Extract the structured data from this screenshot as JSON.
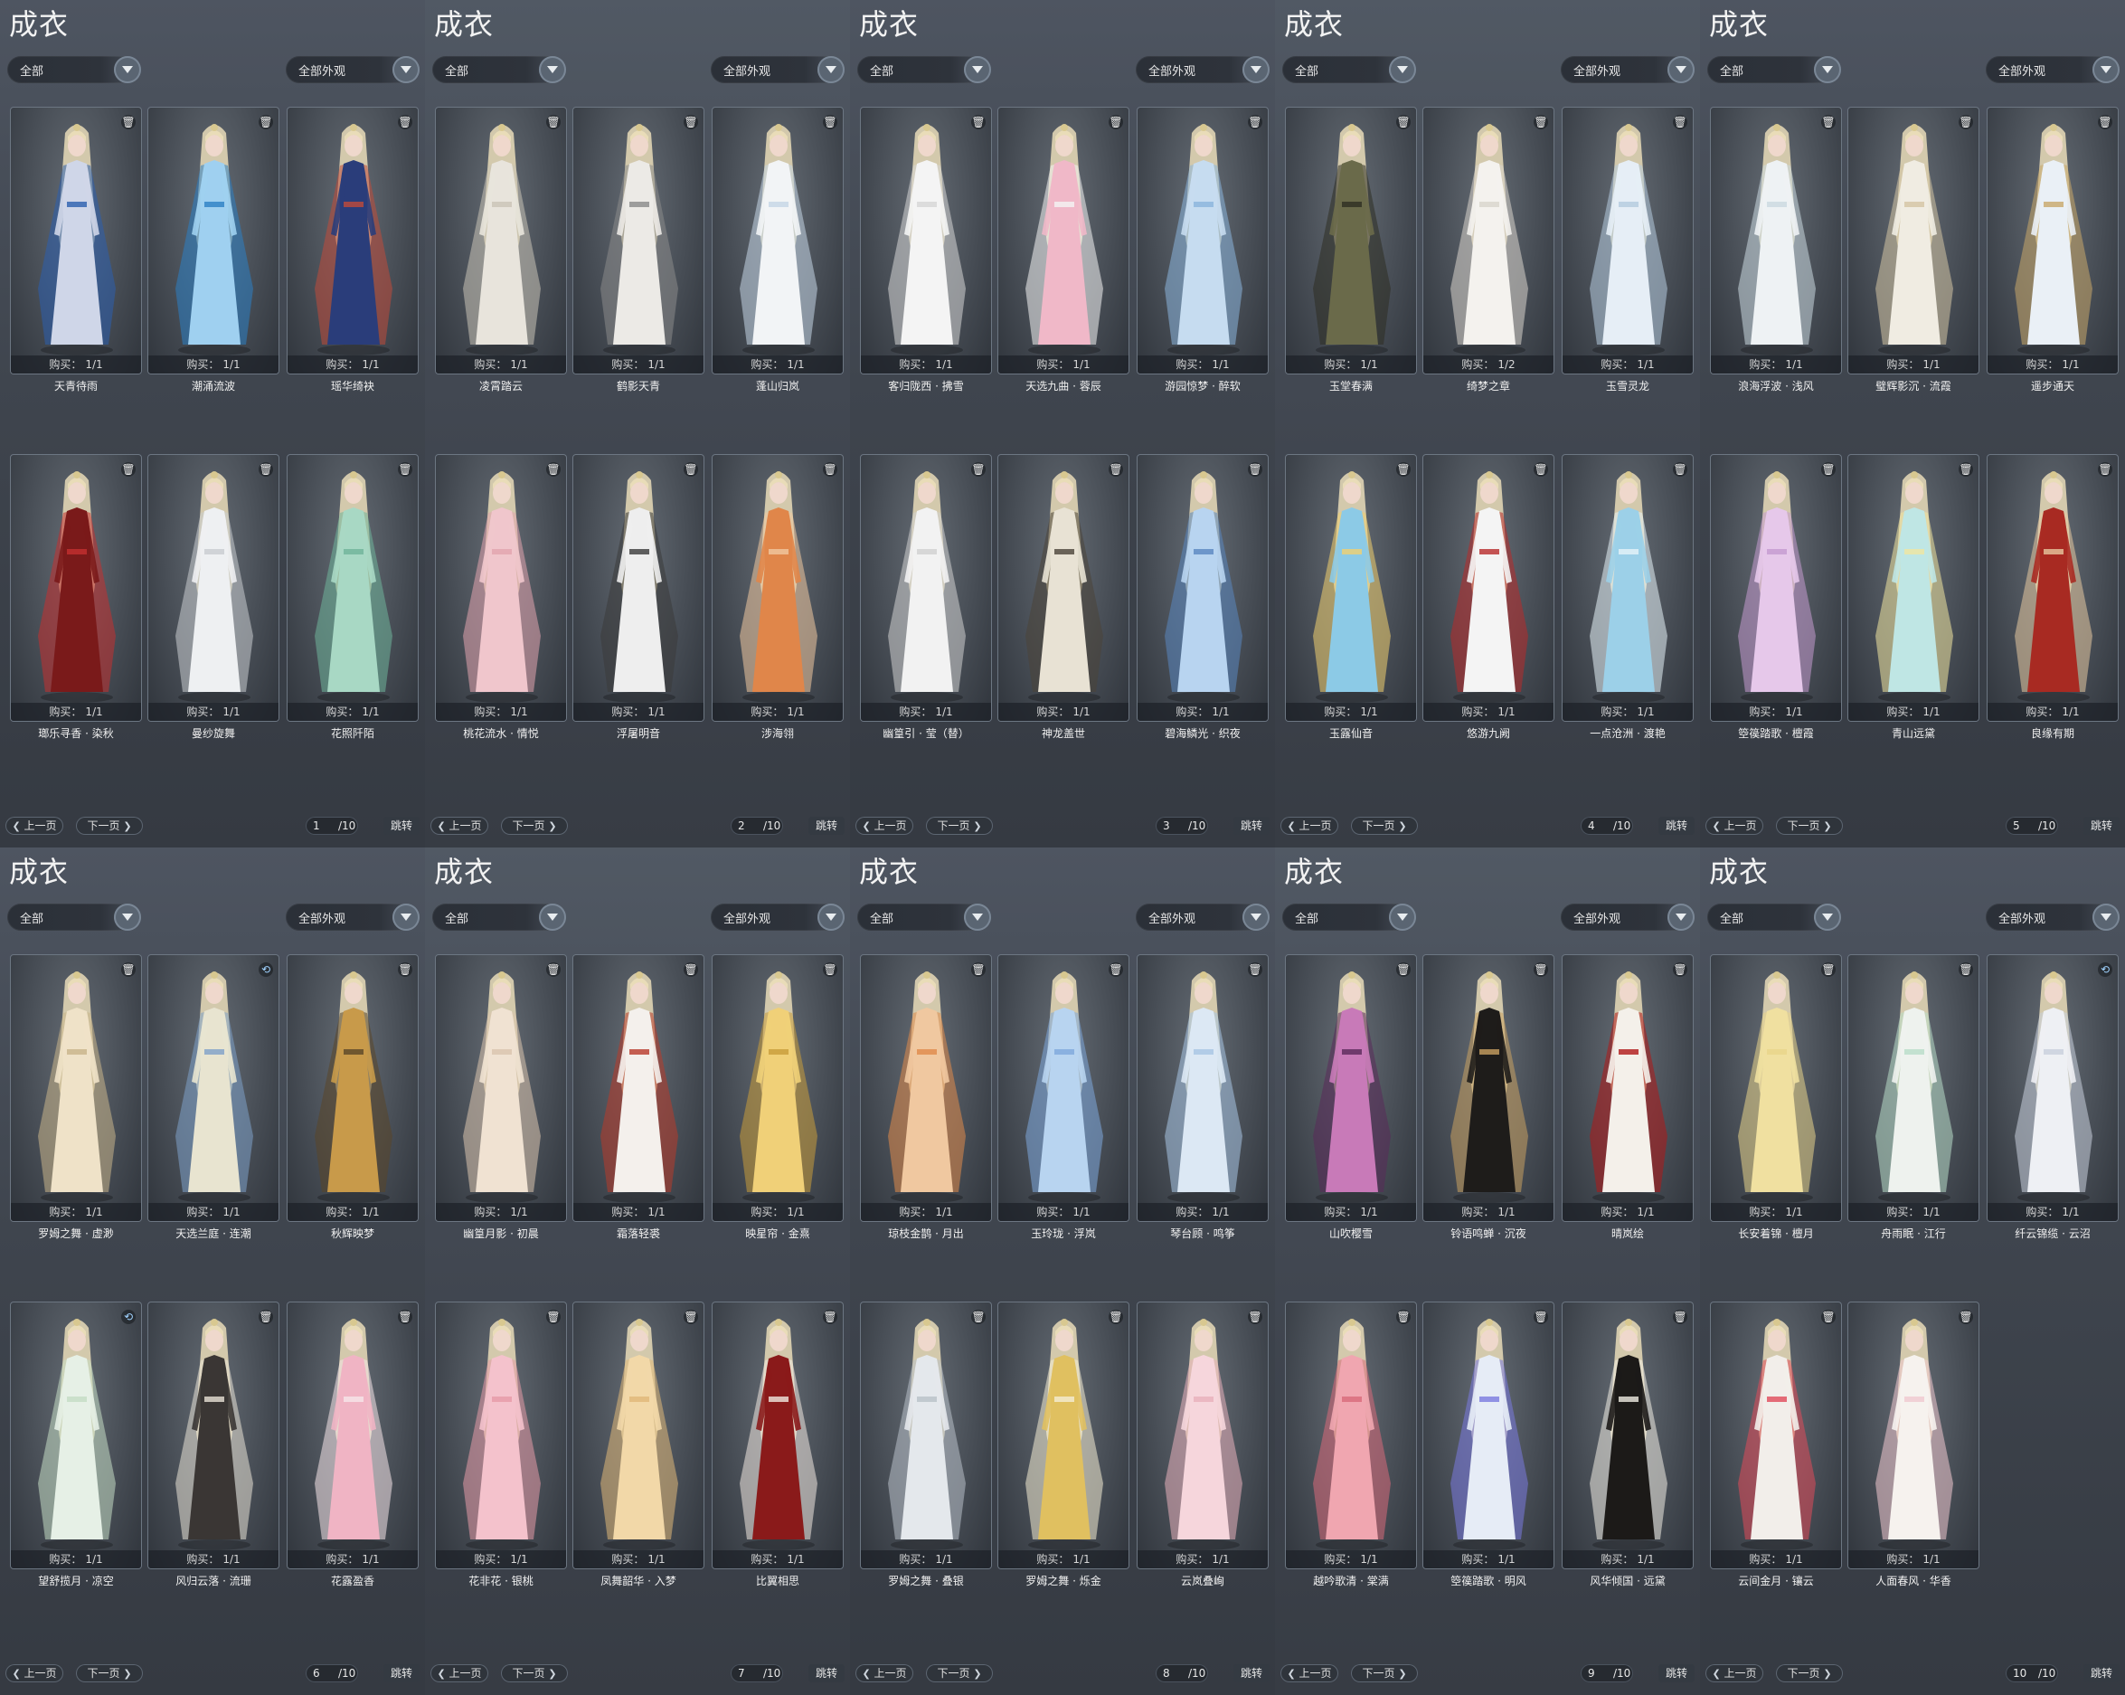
{
  "panel_title": "成衣",
  "filter_left": "全部",
  "filter_right": "全部外观",
  "purchase_label": "购买：",
  "prev_label": "上一页",
  "next_label": "下一页",
  "jump_label": "跳转",
  "total_pages": "/10",
  "colors": {
    "panel_bg": "#454b55",
    "card_border": "#6c7682",
    "text": "#f0f0f0"
  },
  "panels": [
    {
      "page": "1",
      "items": [
        {
          "name": "天青待雨",
          "count": "1/1",
          "icon": "trash-icon",
          "palette": [
            "#cfd6e8",
            "#2b5fae"
          ]
        },
        {
          "name": "潮涌流波",
          "count": "1/1",
          "icon": "trash-icon",
          "palette": [
            "#9fd0f0",
            "#2c7fc4"
          ]
        },
        {
          "name": "瑶华绮袂",
          "count": "1/1",
          "icon": "trash-icon",
          "palette": [
            "#2a3d7a",
            "#c04a3a"
          ]
        },
        {
          "name": "瑯乐寻香 · 染秋",
          "count": "1/1",
          "icon": "trash-icon",
          "palette": [
            "#7a1a1a",
            "#c43030"
          ]
        },
        {
          "name": "曼纱旋舞",
          "count": "1/1",
          "icon": "trash-icon",
          "palette": [
            "#eef0f2",
            "#c8ccd0"
          ]
        },
        {
          "name": "花照阡陌",
          "count": "1/1",
          "icon": "trash-icon",
          "palette": [
            "#a8d8c4",
            "#6fb49a"
          ]
        }
      ]
    },
    {
      "page": "2",
      "items": [
        {
          "name": "凌霄踏云",
          "count": "1/1",
          "icon": "trash-icon",
          "palette": [
            "#e8e4dc",
            "#c9c3b6"
          ]
        },
        {
          "name": "鹤影天青",
          "count": "1/1",
          "icon": "trash-icon",
          "palette": [
            "#eceae6",
            "#8a8a8a"
          ]
        },
        {
          "name": "蓬山归岚",
          "count": "1/1",
          "icon": "trash-icon",
          "palette": [
            "#f2f4f6",
            "#c4d6e6"
          ]
        },
        {
          "name": "桃花流水 · 情悦",
          "count": "1/1",
          "icon": "trash-icon",
          "palette": [
            "#f0c6cc",
            "#e2a4ae"
          ]
        },
        {
          "name": "浮屠明音",
          "count": "1/1",
          "icon": "trash-icon",
          "palette": [
            "#eeeeee",
            "#3a3a3a"
          ]
        },
        {
          "name": "涉海翎",
          "count": "1/1",
          "icon": "trash-icon",
          "palette": [
            "#e0864a",
            "#f0c8a0"
          ]
        }
      ]
    },
    {
      "page": "3",
      "items": [
        {
          "name": "客归陇西 · 拂雪",
          "count": "1/1",
          "icon": "trash-icon",
          "palette": [
            "#f4f4f4",
            "#d6d6d6"
          ]
        },
        {
          "name": "天选九曲 · 蓉辰",
          "count": "1/1",
          "icon": "trash-icon",
          "palette": [
            "#f0b8c8",
            "#f4f4f4"
          ]
        },
        {
          "name": "游园惊梦 · 醉软",
          "count": "1/1",
          "icon": "trash-icon",
          "palette": [
            "#c6dcf0",
            "#8ab4dc"
          ]
        },
        {
          "name": "幽篁引 · 莹（替）",
          "count": "1/1",
          "icon": "trash-icon",
          "palette": [
            "#f2f2f2",
            "#cfcfcf"
          ]
        },
        {
          "name": "神龙盖世",
          "count": "1/1",
          "icon": "trash-icon",
          "palette": [
            "#e8e2d4",
            "#4a4438"
          ]
        },
        {
          "name": "碧海鳞光 · 织夜",
          "count": "1/1",
          "icon": "trash-icon",
          "palette": [
            "#b8d4f0",
            "#5a86c0"
          ]
        }
      ]
    },
    {
      "page": "4",
      "items": [
        {
          "name": "玉堂春满",
          "count": "1/1",
          "icon": "trash-icon",
          "palette": [
            "#6a6a4a",
            "#2e2e22"
          ]
        },
        {
          "name": "绮梦之章",
          "count": "1/2",
          "icon": "trash-icon",
          "palette": [
            "#f4f2ee",
            "#d8d4cc"
          ]
        },
        {
          "name": "玉雪灵龙",
          "count": "1/1",
          "icon": "trash-icon",
          "palette": [
            "#e6eef6",
            "#b4cade"
          ]
        },
        {
          "name": "玉露仙音",
          "count": "1/1",
          "icon": "trash-icon",
          "palette": [
            "#8ccae6",
            "#f0d070"
          ]
        },
        {
          "name": "悠游九阙",
          "count": "1/1",
          "icon": "trash-icon",
          "palette": [
            "#f4f4f4",
            "#b82a2a"
          ]
        },
        {
          "name": "一点沧洲 · 渡艳",
          "count": "1/1",
          "icon": "trash-icon",
          "palette": [
            "#9cd0e8",
            "#e6f2f8"
          ]
        }
      ]
    },
    {
      "page": "5",
      "items": [
        {
          "name": "浪海浮波 · 浅风",
          "count": "1/1",
          "icon": "trash-icon",
          "palette": [
            "#eef2f4",
            "#cad8e0"
          ]
        },
        {
          "name": "璧辉影沉 · 流霞",
          "count": "1/1",
          "icon": "trash-icon",
          "palette": [
            "#f0ece2",
            "#d4c4a4"
          ]
        },
        {
          "name": "遥步通天",
          "count": "1/1",
          "icon": "trash-icon",
          "palette": [
            "#eaf0f6",
            "#c8a86a"
          ]
        },
        {
          "name": "箜篌踏歌 · 檀霞",
          "count": "1/1",
          "icon": "trash-icon",
          "palette": [
            "#e6c8ea",
            "#c49ad0"
          ]
        },
        {
          "name": "青山远黛",
          "count": "1/1",
          "icon": "trash-icon",
          "palette": [
            "#bfe6e4",
            "#f0e6a0"
          ]
        },
        {
          "name": "良缘有期",
          "count": "1/1",
          "icon": "trash-icon",
          "palette": [
            "#a82a22",
            "#e6c8a0"
          ]
        }
      ]
    },
    {
      "page": "6",
      "items": [
        {
          "name": "罗姆之舞 · 虚渺",
          "count": "1/1",
          "icon": "trash-icon",
          "palette": [
            "#efe2c8",
            "#c8b48a"
          ]
        },
        {
          "name": "天选兰庭 · 连潮",
          "count": "1/1",
          "icon": "blue",
          "palette": [
            "#e8e4d0",
            "#7ea0c8"
          ]
        },
        {
          "name": "秋辉映梦",
          "count": "1/1",
          "icon": "trash-icon",
          "palette": [
            "#c89a4a",
            "#5a4628"
          ]
        },
        {
          "name": "望舒揽月 · 凉空",
          "count": "1/1",
          "icon": "blue",
          "palette": [
            "#e6f0e6",
            "#c4dcc4"
          ]
        },
        {
          "name": "风归云落 · 流珊",
          "count": "1/1",
          "icon": "trash-icon",
          "palette": [
            "#3a3634",
            "#e8e2d6"
          ]
        },
        {
          "name": "花露盈香",
          "count": "1/1",
          "icon": "trash-icon",
          "palette": [
            "#f0b4c4",
            "#f6e6ea"
          ]
        }
      ]
    },
    {
      "page": "7",
      "items": [
        {
          "name": "幽篁月影 · 初晨",
          "count": "1/1",
          "icon": "trash-icon",
          "palette": [
            "#f0e2d2",
            "#dac4ae"
          ]
        },
        {
          "name": "霜落轻裘",
          "count": "1/1",
          "icon": "trash-icon",
          "palette": [
            "#f4f0ec",
            "#b83a2a"
          ]
        },
        {
          "name": "映星帘 · 金熹",
          "count": "1/1",
          "icon": "trash-icon",
          "palette": [
            "#f0d078",
            "#c89c3a"
          ]
        },
        {
          "name": "花非花 · 银桃",
          "count": "1/1",
          "icon": "trash-icon",
          "palette": [
            "#f4c2cc",
            "#e69aa8"
          ]
        },
        {
          "name": "凤舞韶华 · 入梦",
          "count": "1/1",
          "icon": "trash-icon",
          "palette": [
            "#f2d8a8",
            "#e0b878"
          ]
        },
        {
          "name": "比翼相思",
          "count": "1/1",
          "icon": "trash-icon",
          "palette": [
            "#8a1a1a",
            "#f0e8e0"
          ]
        }
      ]
    },
    {
      "page": "8",
      "items": [
        {
          "name": "琼枝金鹊 · 月出",
          "count": "1/1",
          "icon": "trash-icon",
          "palette": [
            "#f0c8a0",
            "#e08a4a"
          ]
        },
        {
          "name": "玉玲珑 · 浮岚",
          "count": "1/1",
          "icon": "trash-icon",
          "palette": [
            "#b8d4f0",
            "#7ea8dc"
          ]
        },
        {
          "name": "琴台顾 · 鸣筝",
          "count": "1/1",
          "icon": "trash-icon",
          "palette": [
            "#dce8f4",
            "#a8c4e4"
          ]
        },
        {
          "name": "罗姆之舞 · 叠银",
          "count": "1/1",
          "icon": "trash-icon",
          "palette": [
            "#e4e8ec",
            "#b8c0c8"
          ]
        },
        {
          "name": "罗姆之舞 · 烁金",
          "count": "1/1",
          "icon": "trash-icon",
          "palette": [
            "#e0c060",
            "#f4ecd4"
          ]
        },
        {
          "name": "云岚叠峋",
          "count": "1/1",
          "icon": "trash-icon",
          "palette": [
            "#f6d6dc",
            "#e8b0bc"
          ]
        }
      ]
    },
    {
      "page": "9",
      "items": [
        {
          "name": "山吹樱雪",
          "count": "1/1",
          "icon": "trash-icon",
          "palette": [
            "#c87ab8",
            "#5a2a5a"
          ]
        },
        {
          "name": "铃语鸣蝉 · 沉夜",
          "count": "1/1",
          "icon": "trash-icon",
          "palette": [
            "#1e1c1a",
            "#c8a060"
          ]
        },
        {
          "name": "晴岚绘",
          "count": "1/1",
          "icon": "trash-icon",
          "palette": [
            "#f4f0ea",
            "#b01818"
          ]
        },
        {
          "name": "越吟歌清 · 棠满",
          "count": "1/1",
          "icon": "trash-icon",
          "palette": [
            "#f0a6b0",
            "#d86a7a"
          ]
        },
        {
          "name": "箜篌踏歌 · 明风",
          "count": "1/1",
          "icon": "trash-icon",
          "palette": [
            "#e6ecf6",
            "#7a7ae0"
          ]
        },
        {
          "name": "风华倾国 · 远黛",
          "count": "1/1",
          "icon": "trash-icon",
          "palette": [
            "#1c1a18",
            "#f0ece4"
          ]
        }
      ]
    },
    {
      "page": "10",
      "items": [
        {
          "name": "长安着锦 · 檀月",
          "count": "1/1",
          "icon": "trash-icon",
          "palette": [
            "#f0e0a0",
            "#e8d48a"
          ]
        },
        {
          "name": "舟雨眠 · 江行",
          "count": "1/1",
          "icon": "trash-icon",
          "palette": [
            "#eef2ee",
            "#b8dcc8"
          ]
        },
        {
          "name": "纤云锦缆 · 云沼",
          "count": "1/1",
          "icon": "blue",
          "palette": [
            "#eef0f4",
            "#c8d0dc"
          ]
        },
        {
          "name": "云间金月 · 镶云",
          "count": "1/1",
          "icon": "trash-icon",
          "palette": [
            "#f2eeea",
            "#e04a5a"
          ]
        },
        {
          "name": "人面春风 · 华香",
          "count": "1/1",
          "icon": "trash-icon",
          "palette": [
            "#f6f2ee",
            "#f0c8d0"
          ]
        }
      ]
    }
  ]
}
